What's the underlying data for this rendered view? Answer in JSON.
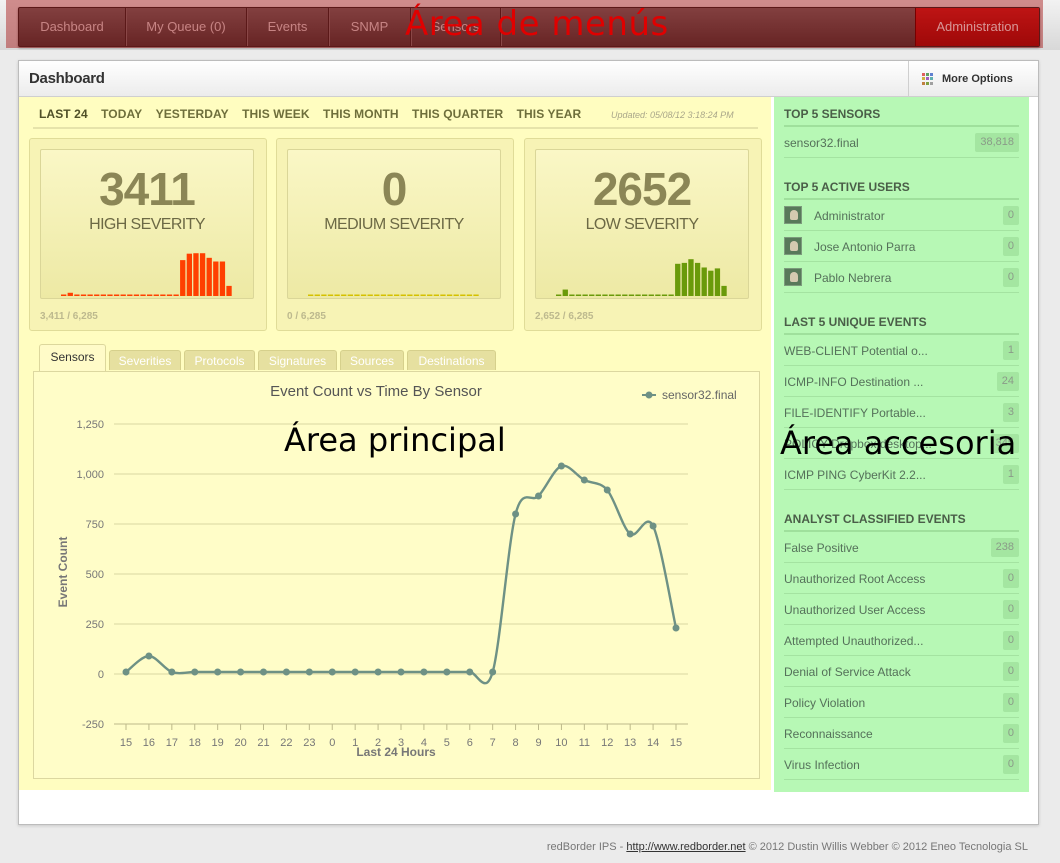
{
  "menu": {
    "items": [
      {
        "label": "Dashboard"
      },
      {
        "label": "My Queue (0)"
      },
      {
        "label": "Events"
      },
      {
        "label": "SNMP"
      },
      {
        "label": "Sensors"
      }
    ],
    "admin_label": "Administration",
    "overlay_label": "Área de menús"
  },
  "panel": {
    "title": "Dashboard",
    "more_options": "More Options"
  },
  "periods": {
    "items": [
      "LAST 24",
      "TODAY",
      "YESTERDAY",
      "THIS WEEK",
      "THIS MONTH",
      "THIS QUARTER",
      "THIS YEAR"
    ],
    "updated": "Updated: 05/08/12 3:18:24 PM"
  },
  "severity": [
    {
      "value": "3411",
      "label": "HIGH SEVERITY",
      "footer": "3,411 / 6,285",
      "color": "#ff3f00",
      "bars": [
        0.03,
        0.07,
        0.03,
        0.03,
        0.03,
        0.03,
        0.03,
        0.03,
        0.03,
        0.03,
        0.03,
        0.03,
        0.03,
        0.03,
        0.03,
        0.03,
        0.03,
        0.03,
        0.78,
        0.92,
        0.93,
        0.93,
        0.83,
        0.75,
        0.75,
        0.22
      ]
    },
    {
      "value": "0",
      "label": "MEDIUM SEVERITY",
      "footer": "0 / 6,285",
      "color": "#d4c000",
      "bars": [
        0.03,
        0.03,
        0.03,
        0.03,
        0.03,
        0.03,
        0.03,
        0.03,
        0.03,
        0.03,
        0.03,
        0.03,
        0.03,
        0.03,
        0.03,
        0.03,
        0.03,
        0.03,
        0.03,
        0.03,
        0.03,
        0.03,
        0.03,
        0.03,
        0.03,
        0.03
      ]
    },
    {
      "value": "2652",
      "label": "LOW SEVERITY",
      "footer": "2,652 / 6,285",
      "color": "#6a9a0a",
      "bars": [
        0.03,
        0.14,
        0.03,
        0.03,
        0.03,
        0.03,
        0.03,
        0.03,
        0.03,
        0.03,
        0.03,
        0.03,
        0.03,
        0.03,
        0.03,
        0.03,
        0.03,
        0.03,
        0.7,
        0.72,
        0.8,
        0.72,
        0.62,
        0.55,
        0.6,
        0.22
      ]
    }
  ],
  "tabs": [
    {
      "label": "Sensors",
      "active": true
    },
    {
      "label": "Severities",
      "active": false
    },
    {
      "label": "Protocols",
      "active": false
    },
    {
      "label": "Signatures",
      "active": false
    },
    {
      "label": "Sources",
      "active": false
    },
    {
      "label": "Destinations",
      "active": false
    }
  ],
  "chart_data": {
    "type": "line",
    "title": "Event Count vs Time By Sensor",
    "xlabel": "Last 24 Hours",
    "ylabel": "Event Count",
    "categories": [
      "15",
      "16",
      "17",
      "18",
      "19",
      "20",
      "21",
      "22",
      "23",
      "0",
      "1",
      "2",
      "3",
      "4",
      "5",
      "6",
      "7",
      "8",
      "9",
      "10",
      "11",
      "12",
      "13",
      "14",
      "15"
    ],
    "series": [
      {
        "name": "sensor32.final",
        "values": [
          10,
          90,
          10,
          10,
          10,
          10,
          10,
          10,
          10,
          10,
          10,
          10,
          10,
          10,
          10,
          10,
          10,
          800,
          890,
          1040,
          970,
          920,
          700,
          740,
          230
        ]
      }
    ],
    "yticks": [
      "1,250",
      "1,000",
      "750",
      "500",
      "250",
      "0",
      "-250"
    ],
    "ytick_values": [
      1250,
      1000,
      750,
      500,
      250,
      0,
      -250
    ],
    "ylim": [
      -250,
      1250
    ],
    "grid": true,
    "legend": "top-right",
    "color": "#6e9185"
  },
  "side": {
    "sections": [
      {
        "title": "TOP 5 SENSORS",
        "rows": [
          {
            "label": "sensor32.final",
            "count": "38,818"
          }
        ]
      },
      {
        "title": "TOP 5 ACTIVE USERS",
        "avatars": true,
        "rows": [
          {
            "label": "Administrator",
            "count": "0"
          },
          {
            "label": "Jose Antonio Parra",
            "count": "0"
          },
          {
            "label": "Pablo Nebrera",
            "count": "0"
          }
        ]
      },
      {
        "title": "LAST 5 UNIQUE EVENTS",
        "rows": [
          {
            "label": "WEB-CLIENT Potential o...",
            "count": "1"
          },
          {
            "label": "ICMP-INFO Destination ...",
            "count": "24"
          },
          {
            "label": "FILE-IDENTIFY Portable...",
            "count": "3"
          },
          {
            "label": "POLICY Dropbox desktop...",
            "count": "345"
          },
          {
            "label": "ICMP PING CyberKit 2.2...",
            "count": "1"
          }
        ]
      },
      {
        "title": "ANALYST CLASSIFIED EVENTS",
        "rows": [
          {
            "label": "False Positive",
            "count": "238"
          },
          {
            "label": "Unauthorized Root Access",
            "count": "0"
          },
          {
            "label": "Unauthorized User Access",
            "count": "0"
          },
          {
            "label": "Attempted Unauthorized...",
            "count": "0"
          },
          {
            "label": "Denial of Service Attack",
            "count": "0"
          },
          {
            "label": "Policy Violation",
            "count": "0"
          },
          {
            "label": "Reconnaissance",
            "count": "0"
          },
          {
            "label": "Virus Infection",
            "count": "0"
          }
        ]
      }
    ]
  },
  "overlays": {
    "main": "Área principal",
    "side": "Área accesoria"
  },
  "footer": {
    "prefix": "redBorder IPS - ",
    "link": "http://www.redborder.net",
    "suffix": " © 2012 Dustin Willis Webber © 2012 Eneo Tecnologia SL"
  }
}
